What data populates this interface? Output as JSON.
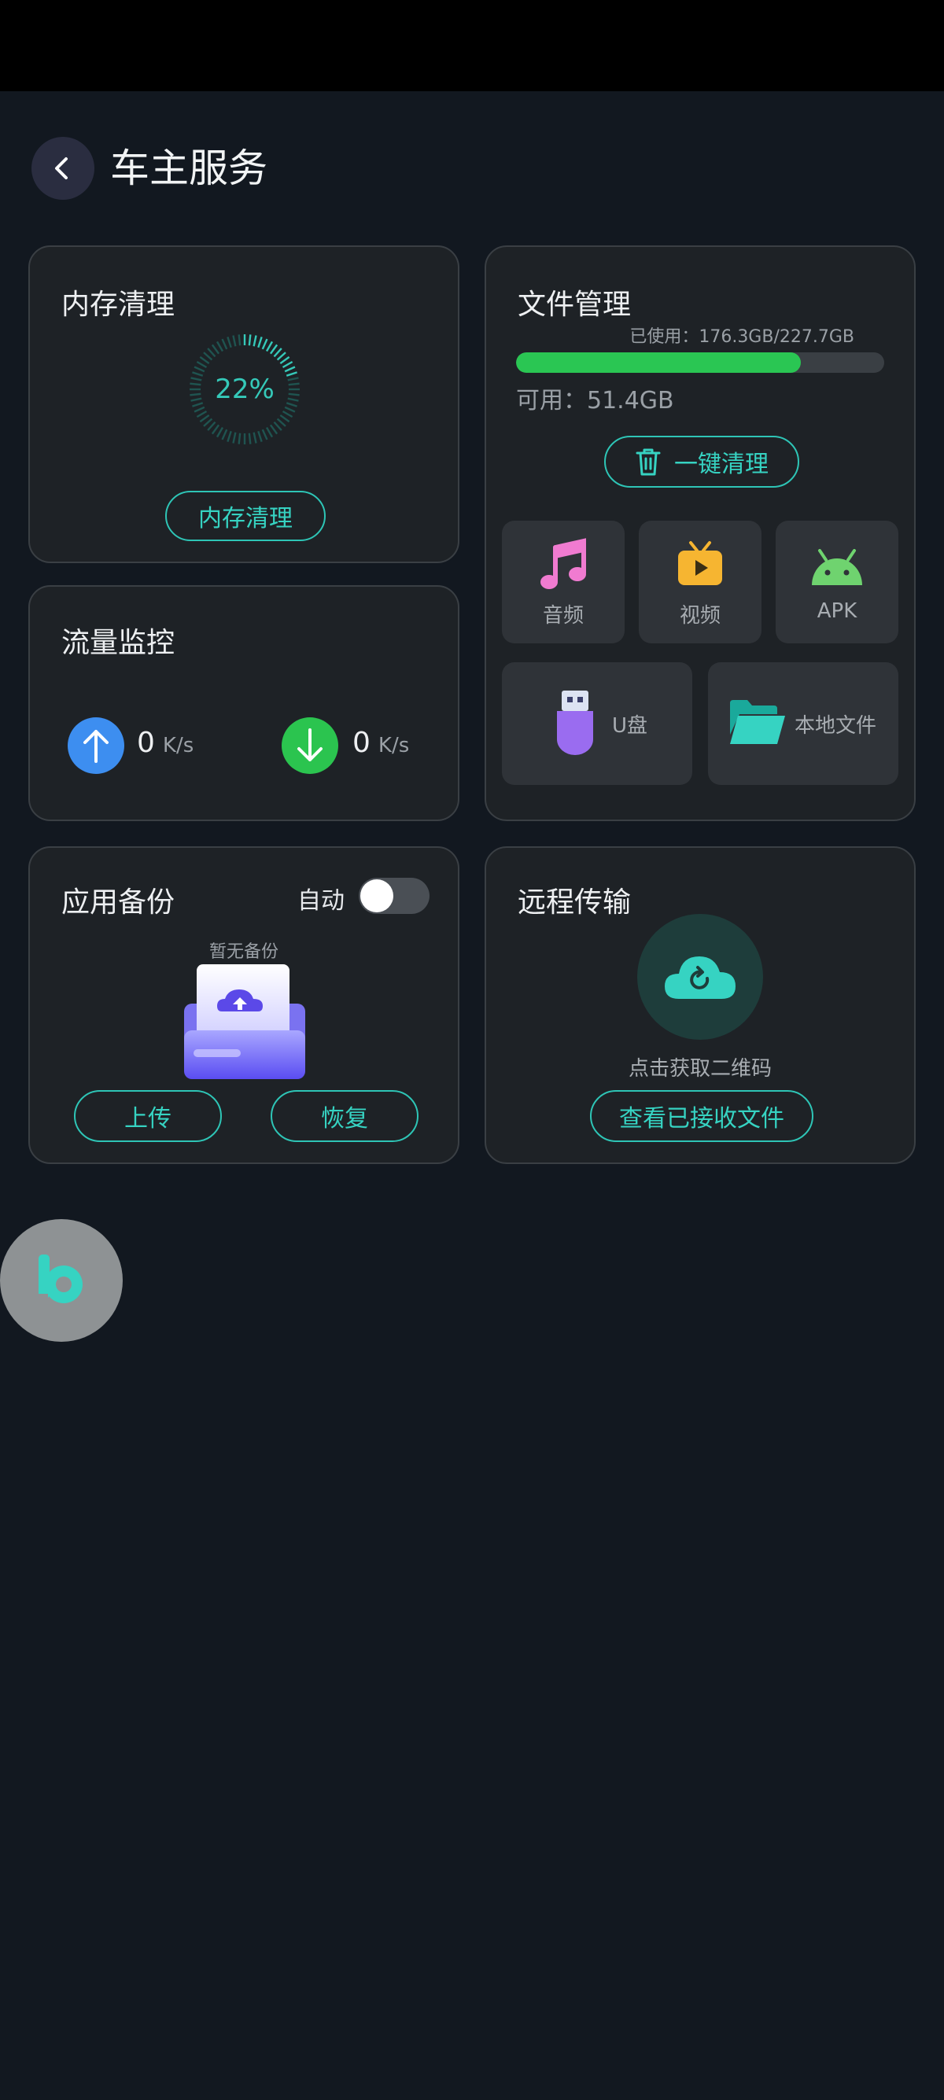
{
  "header": {
    "title": "车主服务"
  },
  "memory": {
    "title": "内存清理",
    "percent": 22,
    "percent_label": "22%",
    "button_label": "内存清理"
  },
  "files": {
    "title": "文件管理",
    "used_label": "已使用：176.3GB/227.7GB",
    "used_fraction": 0.774,
    "avail_label": "可用：51.4GB",
    "clean_label": "一键清理",
    "tiles": [
      {
        "label": "音频",
        "icon": "music-note-icon"
      },
      {
        "label": "视频",
        "icon": "tv-play-icon"
      },
      {
        "label": "APK",
        "icon": "android-icon"
      },
      {
        "label": "U盘",
        "icon": "usb-drive-icon"
      },
      {
        "label": "本地文件",
        "icon": "folder-icon"
      }
    ]
  },
  "traffic": {
    "title": "流量监控",
    "upload_value": "0",
    "download_value": "0",
    "unit": "K/s"
  },
  "backup": {
    "title": "应用备份",
    "auto_label": "自动",
    "auto_enabled": false,
    "empty_label": "暂无备份",
    "upload_label": "上传",
    "restore_label": "恢复"
  },
  "remote": {
    "title": "远程传输",
    "qr_hint": "点击获取二维码",
    "view_label": "查看已接收文件"
  },
  "colors": {
    "accent": "#2ec5b6",
    "progress": "#2ac653",
    "upload": "#3d8ef0",
    "download": "#2bc44f"
  }
}
